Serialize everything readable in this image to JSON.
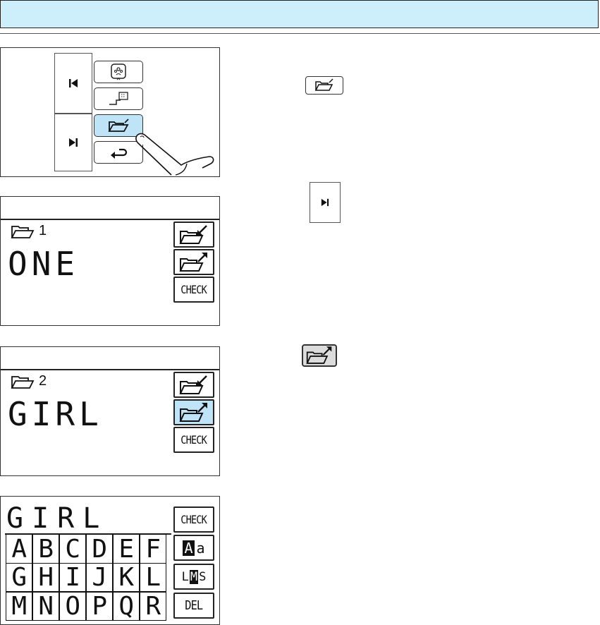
{
  "header": {
    "title": ""
  },
  "panel1": {
    "buttons": [
      {
        "name": "embroidery-pattern-button",
        "icon": "flower-hoop-icon"
      },
      {
        "name": "stitch-pattern-button",
        "icon": "stitch-edit-icon"
      },
      {
        "name": "memory-folder-button",
        "icon": "folder-open-icon"
      },
      {
        "name": "return-button",
        "icon": "return-arrow-icon"
      }
    ],
    "nav": {
      "prev_icon": "previous-page-icon",
      "next_icon": "next-page-icon"
    }
  },
  "panel2": {
    "folder_number": "1",
    "word": "ONE",
    "check_label": "CHECK"
  },
  "panel3": {
    "folder_number": "2",
    "word": "GIRL",
    "check_label": "CHECK"
  },
  "panel4": {
    "word": "GIRL",
    "check_label": "CHECK",
    "case_label_upper": "A",
    "case_label_lower": "a",
    "size_label_l": "L",
    "size_label_m": "M",
    "size_label_s": "S",
    "del_label": "DEL",
    "keys": [
      "A",
      "B",
      "C",
      "D",
      "E",
      "F",
      "G",
      "H",
      "I",
      "J",
      "K",
      "L",
      "M",
      "N",
      "O",
      "P",
      "Q",
      "R"
    ]
  },
  "colors": {
    "header_bg": "#cdeefb",
    "active_bg": "#bfe4f8"
  }
}
